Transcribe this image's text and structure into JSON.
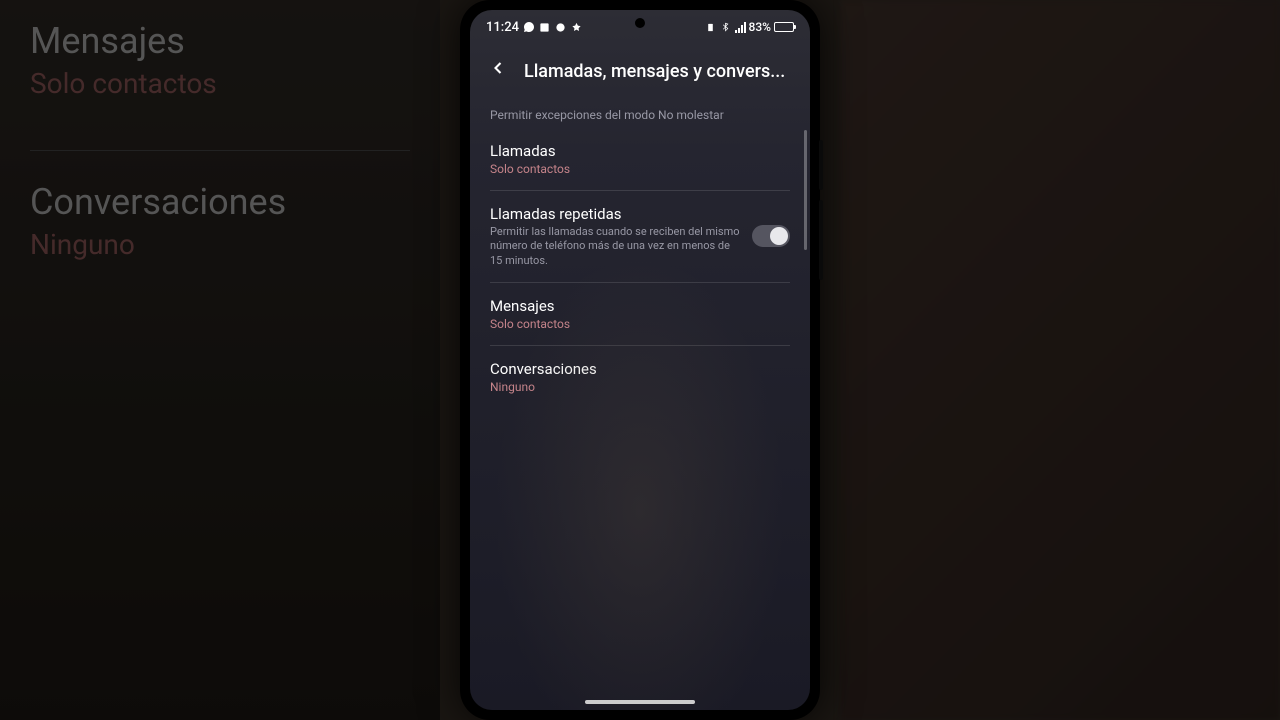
{
  "status_bar": {
    "time": "11:24",
    "battery_percent": "83%",
    "battery_fill_width": "83%"
  },
  "header": {
    "title": "Llamadas, mensajes y convers..."
  },
  "subtitle": "Permitir excepciones del modo No molestar",
  "settings": {
    "calls": {
      "title": "Llamadas",
      "subtitle": "Solo contactos"
    },
    "repeated_calls": {
      "title": "Llamadas repetidas",
      "description": "Permitir las llamadas cuando se reciben del mismo número de teléfono más de una vez en menos de 15 minutos.",
      "toggle_on": true
    },
    "messages": {
      "title": "Mensajes",
      "subtitle": "Solo contactos"
    },
    "conversations": {
      "title": "Conversaciones",
      "subtitle": "Ninguno"
    }
  },
  "bg_left": {
    "item1_title": "Mensajes",
    "item1_sub": "Solo contactos",
    "item2_title": "Conversaciones",
    "item2_sub": "Ninguno"
  }
}
